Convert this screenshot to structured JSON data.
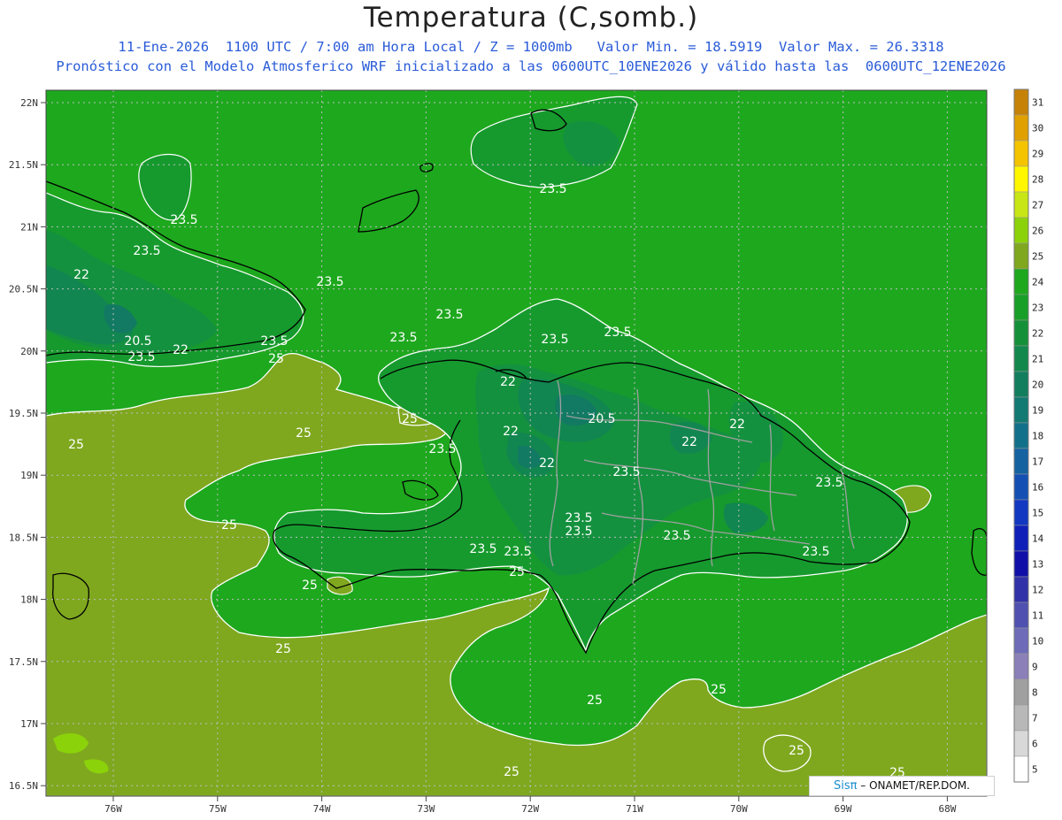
{
  "header": {
    "title": "Temperatura (C,somb.)",
    "line1": "11-Ene-2026  1100 UTC / 7:00 am Hora Local / Z = 1000mb   Valor Min. = 18.5919  Valor Max. = 26.3318",
    "line2": "Pronóstico con el Modelo Atmosferico WRF inicializado a las 0600UTC_10ENE2026 y válido hasta las  0600UTC_12ENE2026"
  },
  "map": {
    "lat_labels": [
      "22N",
      "21.5N",
      "21N",
      "20.5N",
      "20N",
      "19.5N",
      "19N",
      "18.5N",
      "18N",
      "17.5N",
      "17N",
      "16.5N"
    ],
    "lon_labels": [
      "76W",
      "75W",
      "74W",
      "73W",
      "72W",
      "71W",
      "70W",
      "69W",
      "68W"
    ],
    "contour_labels": [
      "23.5",
      "22",
      "20.5",
      "25"
    ],
    "colors": {
      "t25_26": "#7fa81f",
      "t24_25": "#1ea81e",
      "t23_24": "#169a2e",
      "t22_23": "#14913f",
      "t21_22": "#128650",
      "t20_21": "#127a62",
      "contour": "#ffffff",
      "coastline": "#000000",
      "provinces": "#a0a0a0"
    }
  },
  "legend": {
    "values": [
      "31",
      "30",
      "29",
      "28",
      "27",
      "26",
      "25",
      "24",
      "23",
      "22",
      "21",
      "20",
      "19",
      "18",
      "17",
      "16",
      "15",
      "14",
      "13",
      "12",
      "11",
      "10",
      "9",
      "8",
      "7",
      "6",
      "5"
    ],
    "colors": [
      "#c68207",
      "#e0a000",
      "#f5c400",
      "#fff700",
      "#c8e616",
      "#8cd20a",
      "#7fa81f",
      "#1ea81e",
      "#189f28",
      "#149138",
      "#12884c",
      "#127e5e",
      "#127a72",
      "#13708a",
      "#1462a0",
      "#1450b4",
      "#1238c2",
      "#0f20b8",
      "#1010a8",
      "#3232a8",
      "#5050b0",
      "#6e6cb8",
      "#8c80b8",
      "#a0a0a0",
      "#b8b8b8",
      "#d8d8d8",
      "#ffffff"
    ]
  },
  "credit": {
    "brand": "Sisπ",
    "text": " – ONAMET/REP.DOM."
  }
}
